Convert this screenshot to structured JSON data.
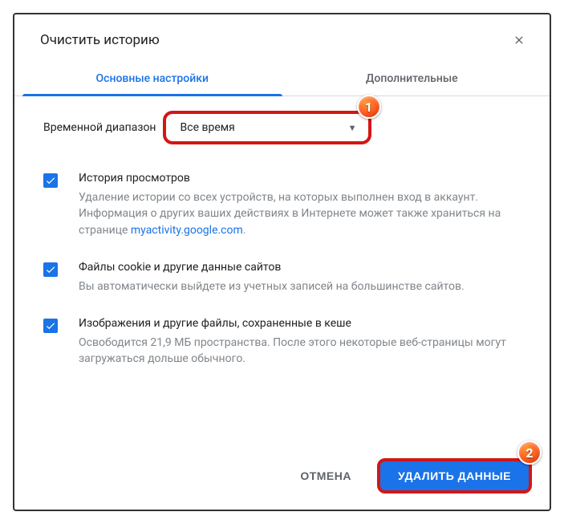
{
  "dialog": {
    "title": "Очистить историю",
    "close_label": "Закрыть"
  },
  "tabs": {
    "basic": "Основные настройки",
    "advanced": "Дополнительные"
  },
  "time_range": {
    "label": "Временной диапазон",
    "selected": "Все время"
  },
  "annotations": {
    "marker1": "1",
    "marker2": "2"
  },
  "options": [
    {
      "title": "История просмотров",
      "desc_pre": "Удаление истории со всех устройств, на которых выполнен вход в аккаунт. Информация о других ваших действиях в Интернете может также храниться на странице ",
      "link_text": "myactivity.google.com",
      "desc_post": "."
    },
    {
      "title": "Файлы cookie и другие данные сайтов",
      "desc_pre": "Вы автоматически выйдете из учетных записей на большинстве сайтов.",
      "link_text": "",
      "desc_post": ""
    },
    {
      "title": "Изображения и другие файлы, сохраненные в кеше",
      "desc_pre": "Освободится 21,9 МБ пространства. После этого некоторые веб-страницы могут загружаться дольше обычного.",
      "link_text": "",
      "desc_post": ""
    }
  ],
  "footer": {
    "cancel": "ОТМЕНА",
    "confirm": "УДАЛИТЬ ДАННЫЕ"
  },
  "colors": {
    "accent": "#1a73e8",
    "annotation_border": "#d31616"
  }
}
